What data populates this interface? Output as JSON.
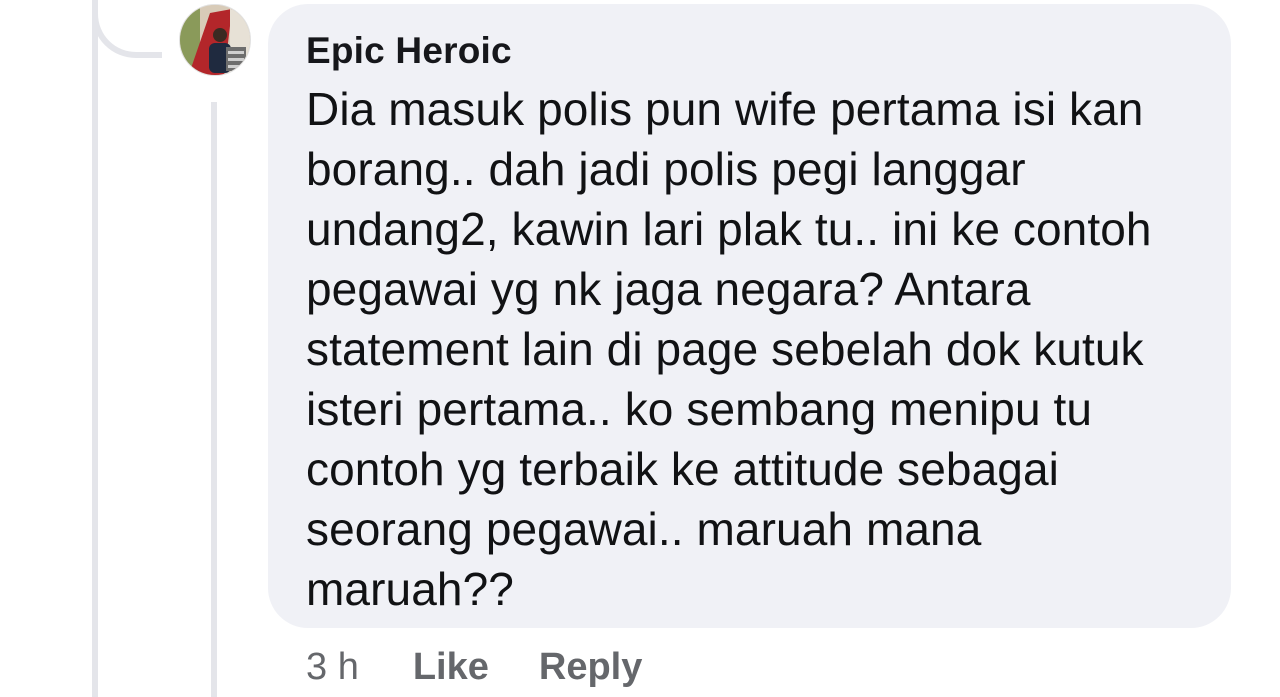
{
  "comment": {
    "author": "Epic Heroic",
    "text": "Dia masuk polis pun wife pertama isi kan\nborang.. dah jadi polis pegi langgar\nundang2, kawin lari plak tu.. ini ke contoh\npegawai yg nk jaga negara? Antara\nstatement lain di page sebelah dok kutuk\nisteri pertama.. ko sembang menipu tu\ncontoh yg terbaik ke attitude sebagai\nseorang pegawai.. maruah mana\nmaruah??",
    "timestamp": "3 h",
    "like_label": "Like",
    "reply_label": "Reply"
  },
  "colors": {
    "bubble_bg": "#f0f1f6",
    "thread_line": "#e4e5ea",
    "meta_text": "#65676b",
    "body_text": "#111214"
  },
  "icons": {
    "avatar": "profile-photo"
  }
}
